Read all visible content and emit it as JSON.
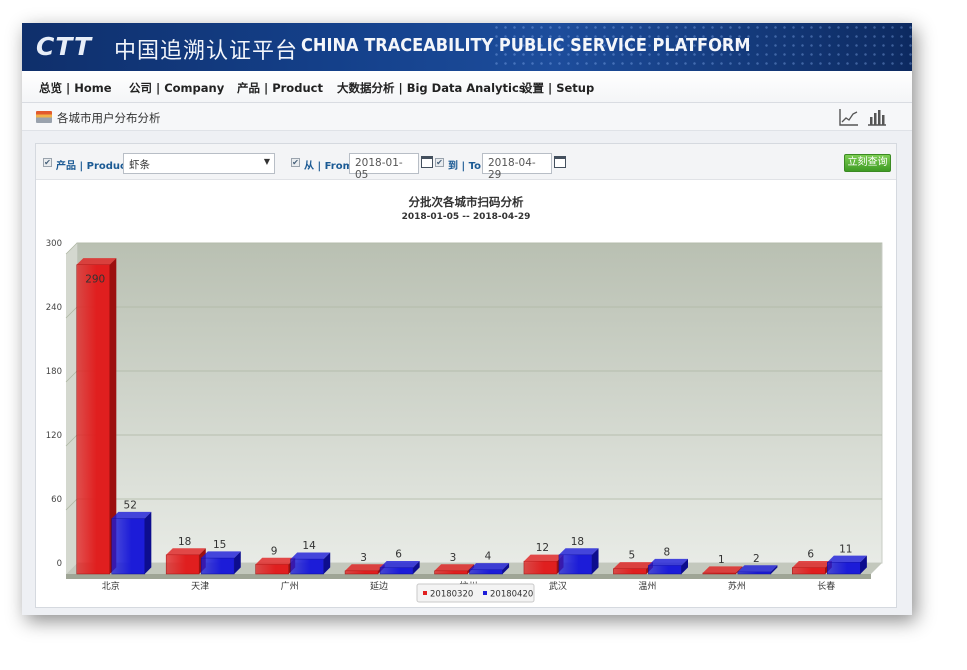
{
  "header": {
    "logo_text": "CTT",
    "cn_title": "中国追溯认证平台",
    "en_title": "CHINA TRACEABILITY PUBLIC SERVICE PLATFORM"
  },
  "nav": {
    "items": [
      {
        "label": "总览 | Home"
      },
      {
        "label": "公司 | Company"
      },
      {
        "label": "产品 | Product"
      },
      {
        "label": "大数据分析 | Big Data Analytics"
      },
      {
        "label": "设置 | Setup"
      }
    ]
  },
  "page": {
    "title": "各城市用户分布分析",
    "view_icons": [
      "line-chart-icon",
      "bar-chart-icon"
    ]
  },
  "filter": {
    "product_label": "产品 | Product:",
    "product_value": "虾条",
    "from_label": "从 | From:",
    "from_value": "2018-01-05",
    "to_label": "到 | To:",
    "to_value": "2018-04-29",
    "query_button": "立刻查询",
    "checkbox_mark": "✔"
  },
  "colors": {
    "series1": "#e01f1f",
    "series2": "#1c1cd8",
    "plot_bg_top": "#b9c0b2",
    "plot_bg_bottom": "#e8ebe6",
    "query_button": "#4fa62e"
  },
  "chart_data": {
    "type": "bar",
    "title": "分批次各城市扫码分析",
    "subtitle": "2018-01-05 -- 2018-04-29",
    "categories": [
      "北京",
      "天津",
      "广州",
      "延边",
      "杭州",
      "武汉",
      "温州",
      "苏州",
      "长春"
    ],
    "series": [
      {
        "name": "20180320",
        "values": [
          290,
          18,
          9,
          3,
          3,
          12,
          5,
          1,
          6
        ]
      },
      {
        "name": "20180420",
        "values": [
          52,
          15,
          14,
          6,
          4,
          18,
          8,
          2,
          11
        ]
      }
    ],
    "yticks": [
      0,
      60,
      120,
      180,
      240,
      300
    ],
    "ylim": [
      0,
      300
    ],
    "grid": true,
    "legend_position": "bottom-center",
    "style": "3d"
  }
}
